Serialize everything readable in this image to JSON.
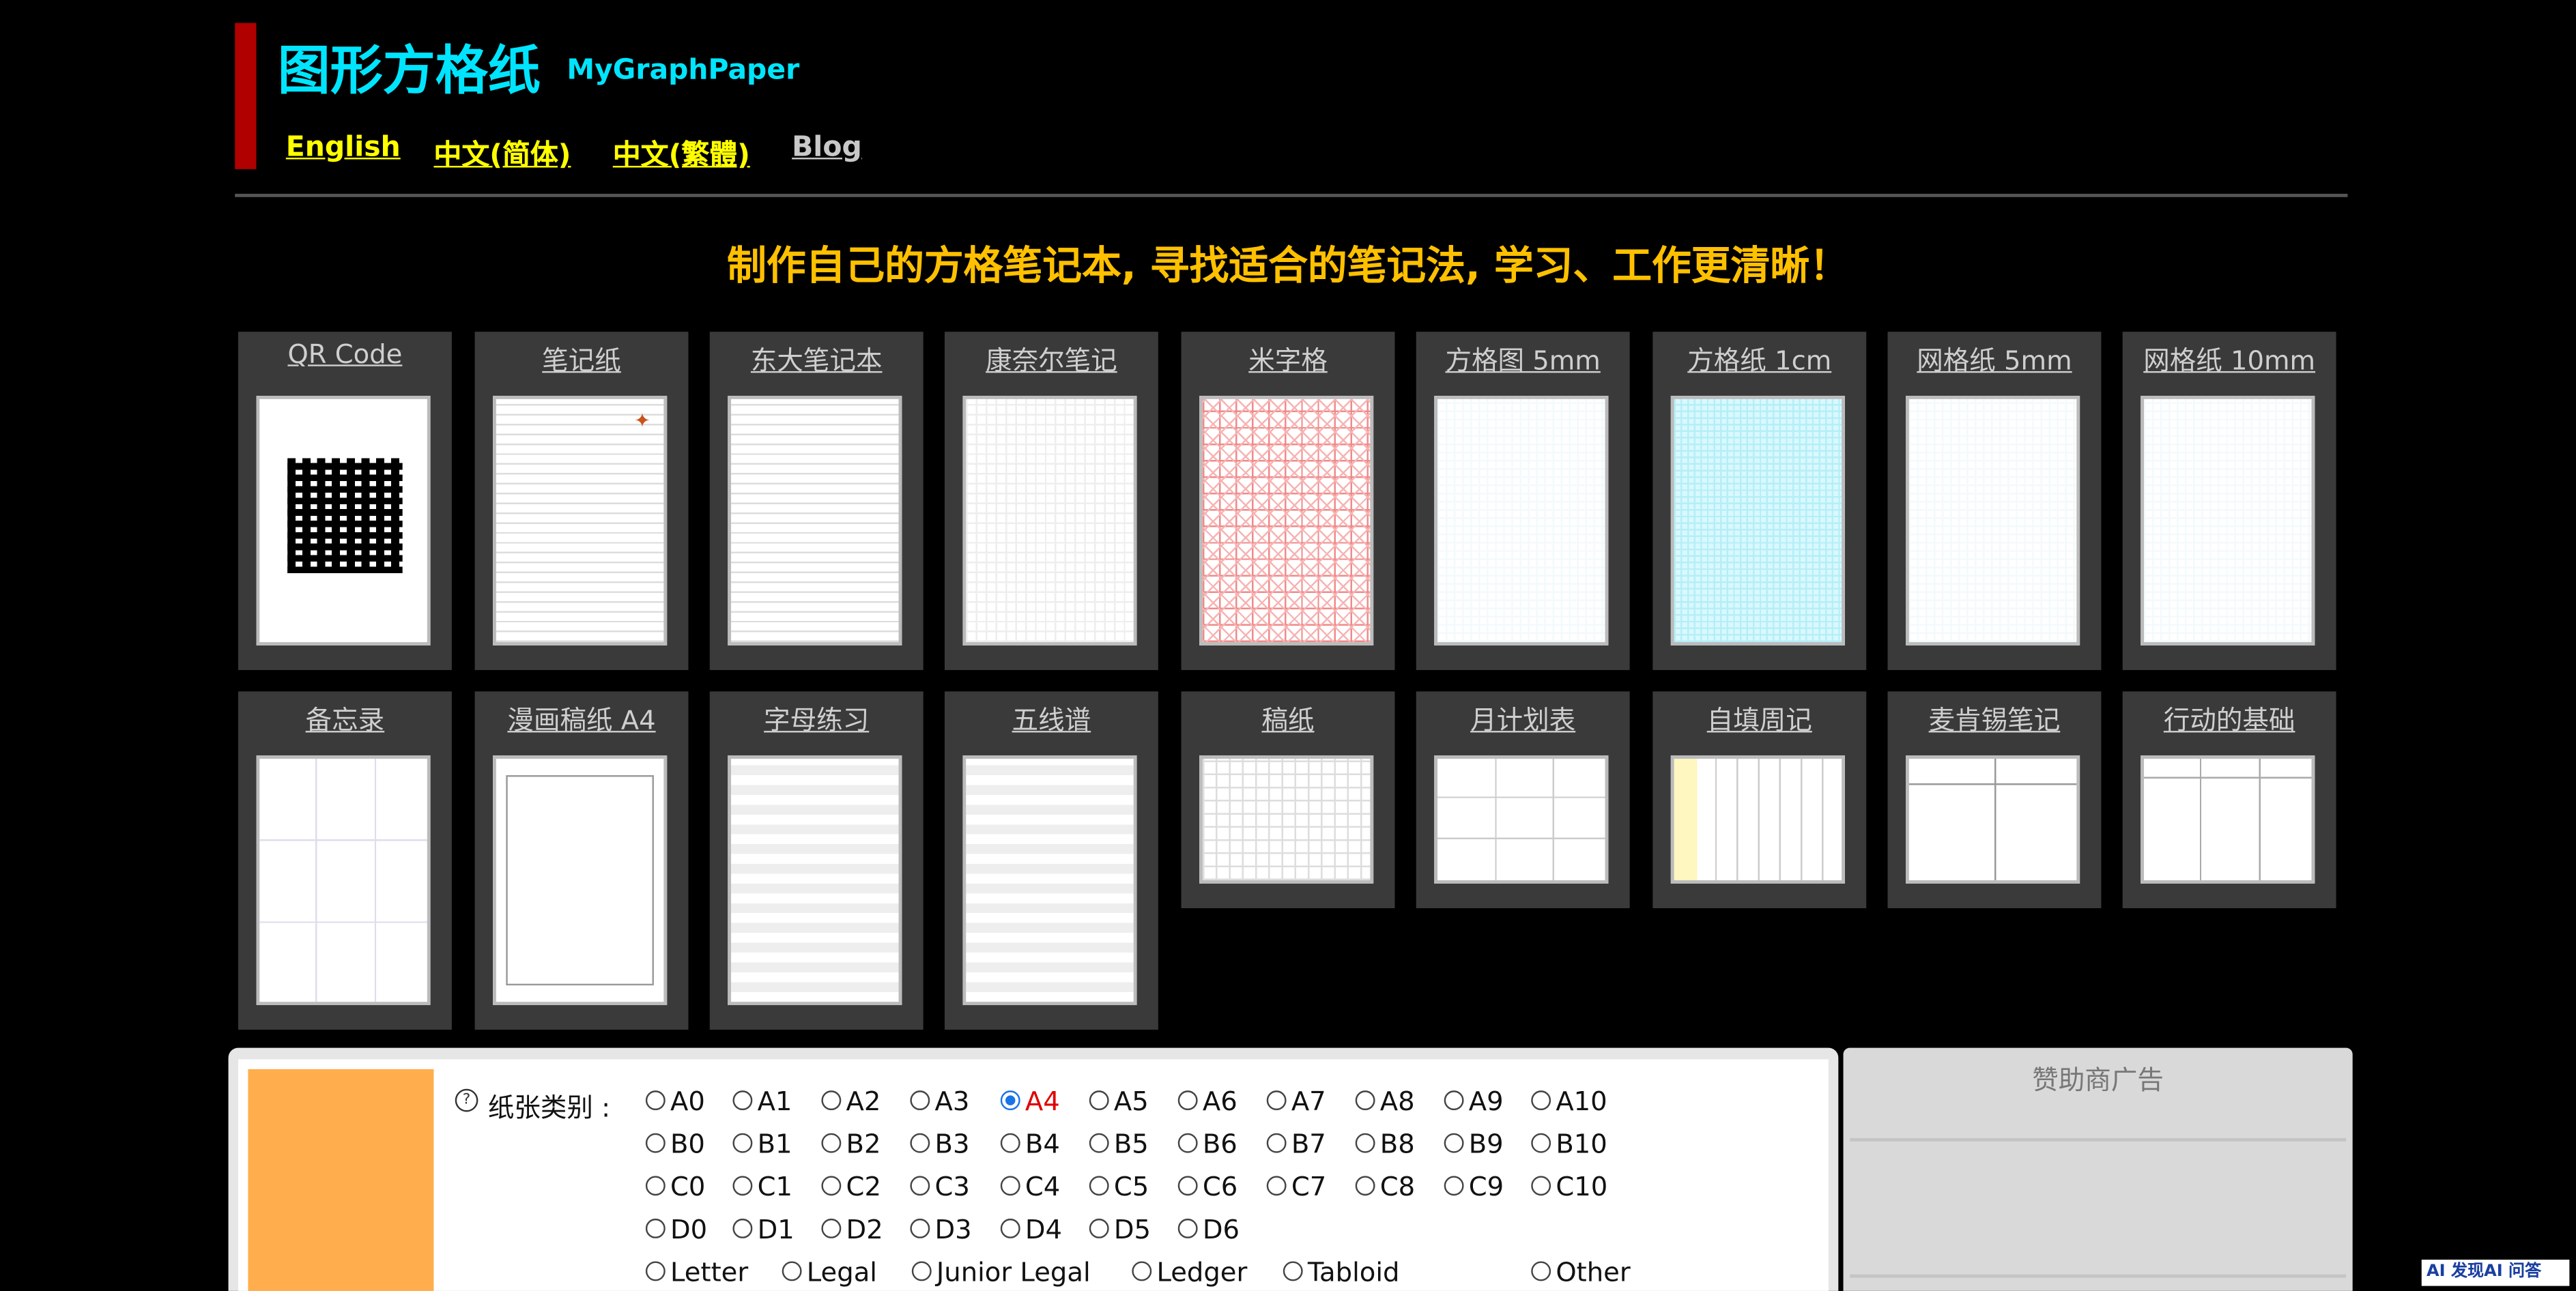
{
  "header": {
    "title_cn": "图形方格纸",
    "title_en": "MyGraphPaper",
    "nav": [
      "English",
      "中文(简体)",
      "中文(繁體)",
      "Blog"
    ]
  },
  "tagline": "制作自己的方格笔记本, 寻找适合的笔记法, 学习、工作更清晰！",
  "templates": [
    "QR Code",
    "笔记纸",
    "东大笔记本",
    "康奈尔笔记",
    "米字格",
    "方格图 5mm",
    "方格纸 1cm",
    "网格纸 5mm",
    "网格纸 10mm",
    "备忘录",
    "漫画稿纸 A4",
    "字母练习",
    "五线谱",
    "稿纸",
    "月计划表",
    "自填周记",
    "麦肯锡笔记",
    "行动的基础"
  ],
  "paper_type": {
    "label": "纸张类别 :",
    "help_icon": "question-circle-icon",
    "selected": "A4",
    "rows": [
      [
        "A0",
        "A1",
        "A2",
        "A3",
        "A4",
        "A5",
        "A6",
        "A7",
        "A8",
        "A9",
        "A10"
      ],
      [
        "B0",
        "B1",
        "B2",
        "B3",
        "B4",
        "B5",
        "B6",
        "B7",
        "B8",
        "B9",
        "B10"
      ],
      [
        "C0",
        "C1",
        "C2",
        "C3",
        "C4",
        "C5",
        "C6",
        "C7",
        "C8",
        "C9",
        "C10"
      ],
      [
        "D0",
        "D1",
        "D2",
        "D3",
        "D4",
        "D5",
        "D6"
      ],
      [
        "Letter",
        "Legal",
        "Junior Legal",
        "Ledger",
        "Tabloid",
        "Other"
      ]
    ]
  },
  "sponsor": {
    "title": "赞助商广告"
  },
  "badge": "AI 发现AI 问答",
  "colors": {
    "background": "#000000",
    "title": "#00e5ff",
    "nav": "#ffff00",
    "tagline": "#ffc000",
    "accent_bar": "#b00000",
    "card": "#3a3a3a",
    "selected": "#e00000",
    "preview_block": "#ffad4d"
  }
}
